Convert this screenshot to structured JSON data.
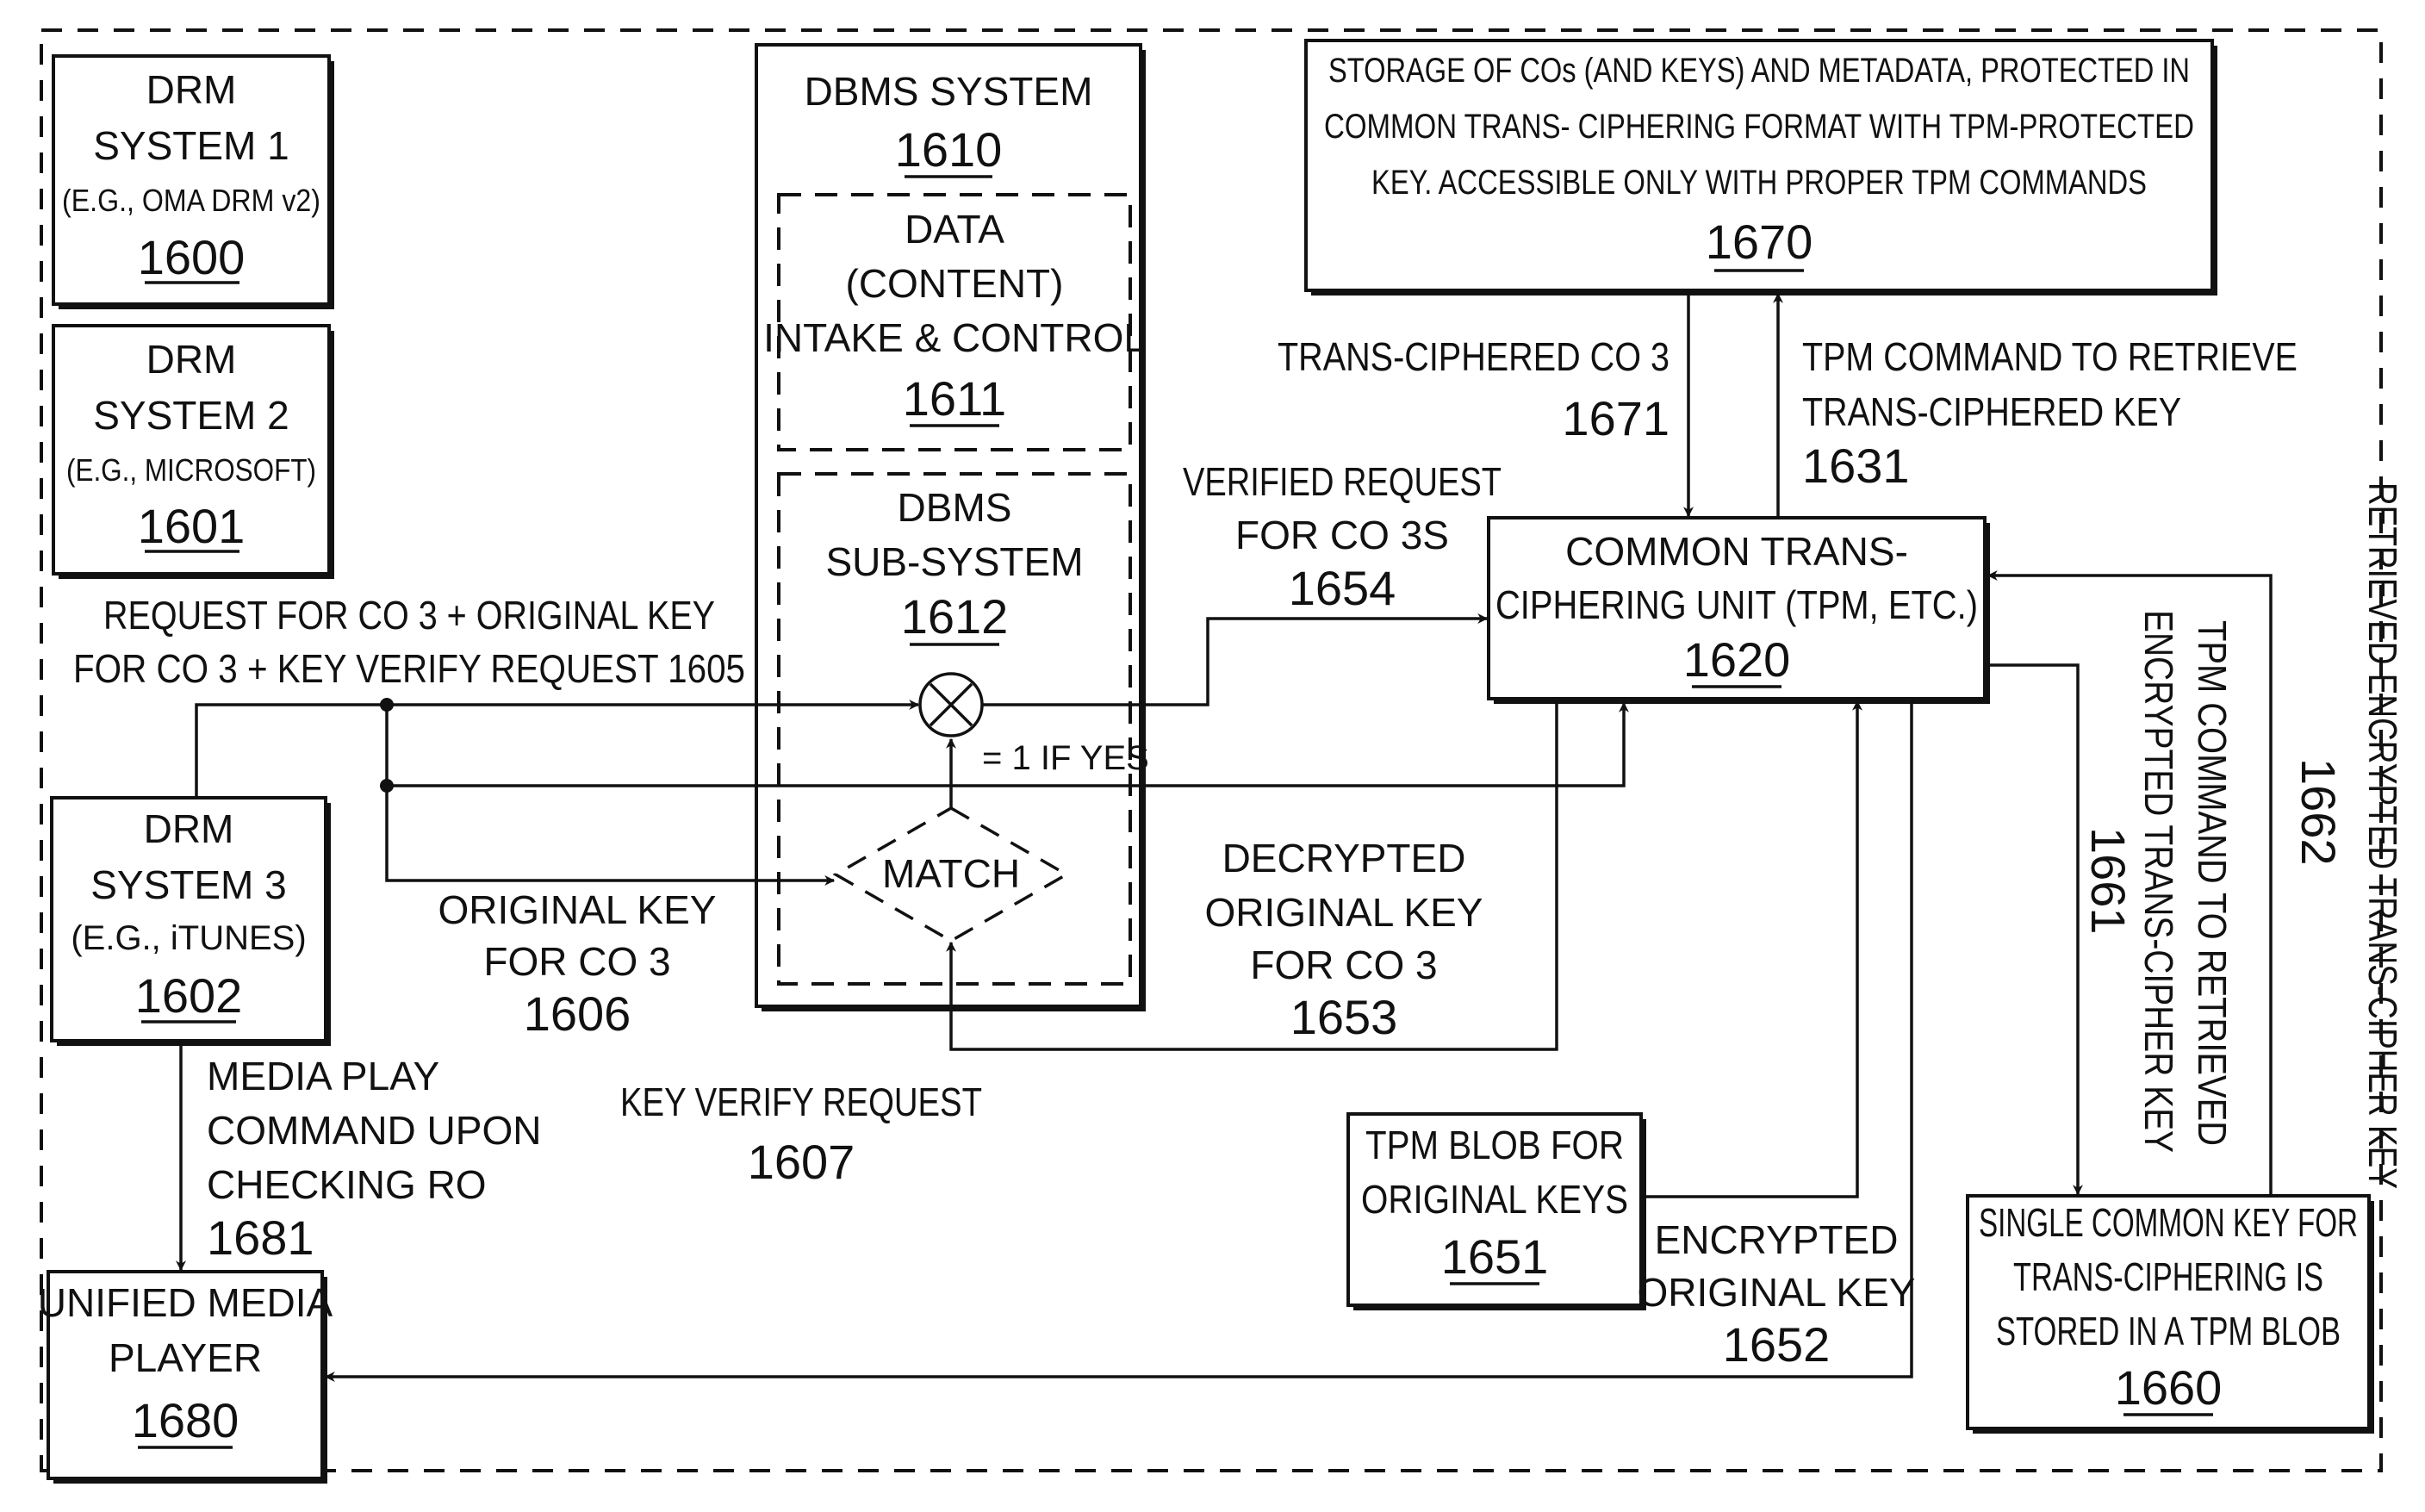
{
  "figure": {
    "drm1": {
      "lines": [
        "DRM",
        "SYSTEM 1",
        "(E.G., OMA DRM v2)"
      ],
      "ref": "1600"
    },
    "drm2": {
      "lines": [
        "DRM",
        "SYSTEM 2",
        "(E.G., MICROSOFT)"
      ],
      "ref": "1601"
    },
    "drm3": {
      "lines": [
        "DRM",
        "SYSTEM 3",
        "(E.G., iTUNES)"
      ],
      "ref": "1602"
    },
    "player": {
      "lines": [
        "UNIFIED MEDIA",
        "PLAYER"
      ],
      "ref": "1680"
    },
    "dbms": {
      "lines": [
        "DBMS SYSTEM"
      ],
      "ref": "1610"
    },
    "intake": {
      "lines": [
        "DATA",
        "(CONTENT)",
        "INTAKE & CONTROL"
      ],
      "ref": "1611"
    },
    "subsystem": {
      "lines": [
        "DBMS",
        "SUB-SYSTEM"
      ],
      "ref": "1612"
    },
    "match": {
      "label": "MATCH"
    },
    "multiplier": {
      "symbol": "×"
    },
    "if_yes": "= 1 IF YES",
    "storage": {
      "lines": [
        "STORAGE OF COs (AND KEYS) AND METADATA, PROTECTED IN",
        "COMMON TRANS- CIPHERING FORMAT WITH TPM-PROTECTED",
        "KEY. ACCESSIBLE ONLY WITH PROPER TPM COMMANDS"
      ],
      "ref": "1670"
    },
    "unit": {
      "lines": [
        "COMMON TRANS-",
        "CIPHERING UNIT  (TPM, ETC.)"
      ],
      "ref": "1620"
    },
    "tpm_blob": {
      "lines": [
        "TPM BLOB FOR",
        "ORIGINAL KEYS"
      ],
      "ref": "1651"
    },
    "single_key": {
      "lines": [
        "SINGLE COMMON KEY FOR",
        "TRANS-CIPHERING IS",
        "STORED IN A TPM BLOB"
      ],
      "ref": "1660"
    }
  },
  "labels": {
    "request_1605": [
      "REQUEST FOR CO 3 + ORIGINAL KEY",
      "FOR CO 3 + KEY VERIFY REQUEST 1605"
    ],
    "original_key_1606": [
      "ORIGINAL KEY",
      "FOR CO 3",
      "1606"
    ],
    "key_verify_1607": [
      "KEY VERIFY REQUEST",
      "1607"
    ],
    "media_play_1681": [
      "MEDIA PLAY",
      "COMMAND UPON",
      "CHECKING RO",
      "1681"
    ],
    "verified_1654": [
      "VERIFIED REQUEST",
      "FOR CO 3S",
      "1654"
    ],
    "decrypted_1653": [
      "DECRYPTED",
      "ORIGINAL KEY",
      "FOR CO 3",
      "1653"
    ],
    "trans_ciphered_1671": [
      "TRANS-CIPHERED CO 3",
      "1671"
    ],
    "tpm_cmd_1631": [
      "TPM COMMAND TO RETRIEVE",
      "TRANS-CIPHERED KEY",
      "1631"
    ],
    "encrypted_1652": [
      "ENCRYPTED",
      "ORIGINAL KEY",
      "1652"
    ],
    "tpm_cmd_1661": [
      "TPM COMMAND TO RETRIEVED",
      "ENCRYPTED TRANS-CIPHER KEY",
      "1661"
    ],
    "retrieved_1662": [
      "RETRIEVED ENCRYPTED TRANS-CIPHER KEY",
      "1662"
    ]
  }
}
